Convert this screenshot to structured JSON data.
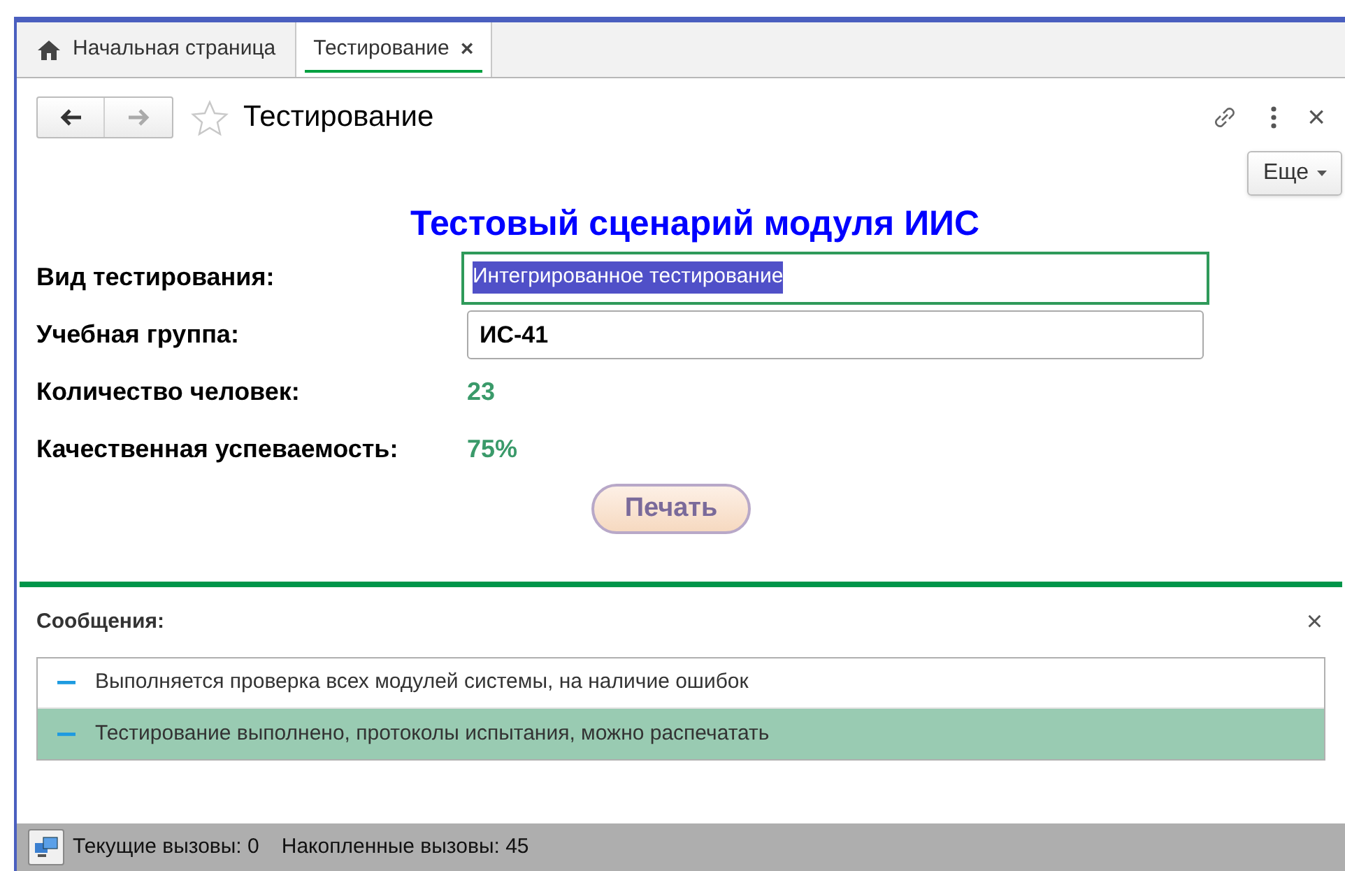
{
  "tabs": [
    {
      "kind": "home",
      "label": "Начальная страница",
      "selected": false,
      "closable": false
    },
    {
      "kind": "page",
      "label": "Тестирование",
      "selected": true,
      "closable": true,
      "close": "×"
    }
  ],
  "form": {
    "title": "Тестирование",
    "close": "×",
    "more_button": "Еще"
  },
  "heading": "Тестовый сценарий модуля ИИС",
  "fields": [
    {
      "kind": "input",
      "label": "Вид тестирования:",
      "value": "Интегрированное тестирование",
      "focused": true,
      "highlighted": true
    },
    {
      "kind": "input",
      "label": "Учебная группа:",
      "value": "ИС-41",
      "focused": false,
      "highlighted": false
    },
    {
      "kind": "value",
      "label": "Количество человек:",
      "value": "23"
    },
    {
      "kind": "value",
      "label": "Качественная успеваемость:",
      "value": "75%"
    }
  ],
  "print_button": "Печать",
  "messages": {
    "title": "Сообщения:",
    "close": "×",
    "items": [
      {
        "text": "Выполняется проверка всех модулей системы, на наличие ошибок",
        "selected": false
      },
      {
        "text": "Тестирование выполнено, протоколы испытания, можно распечатать",
        "selected": true
      }
    ]
  },
  "status_bar": {
    "current": "Текущие вызовы: 0",
    "accumulated": "Накопленные вызовы: 45"
  }
}
